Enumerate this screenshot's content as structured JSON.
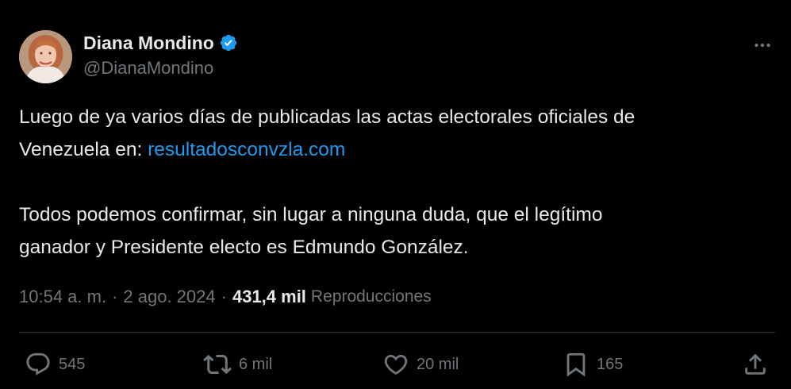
{
  "author": {
    "name": "Diana Mondino",
    "handle": "@DianaMondino",
    "verified": true
  },
  "tweet": {
    "line1": "Luego de ya varios días de publicadas las actas electorales oficiales de",
    "line2_prefix": "Venezuela en: ",
    "link": "resultadosconvzla.com",
    "line3": "Todos podemos confirmar, sin lugar a ninguna duda, que el legítimo",
    "line4": "ganador y Presidente electo es Edmundo González."
  },
  "meta": {
    "time": "10:54 a. m.",
    "separator": "·",
    "date": "2 ago. 2024",
    "views_count": "431,4 mil",
    "views_label": "Reproducciones"
  },
  "actions": {
    "replies": "545",
    "reposts": "6 mil",
    "likes": "20 mil",
    "bookmarks": "165"
  },
  "colors": {
    "background": "#000000",
    "text_primary": "#e7e9ea",
    "text_secondary": "#71767b",
    "link": "#1d9bf0",
    "divider": "#2f3336",
    "verified": "#1d9bf0"
  },
  "icons": {
    "verified": "verified-badge-icon",
    "more": "more-dots-icon",
    "reply": "reply-bubble-icon",
    "repost": "repost-arrows-icon",
    "like": "heart-icon",
    "bookmark": "bookmark-icon",
    "share": "share-upload-icon"
  }
}
